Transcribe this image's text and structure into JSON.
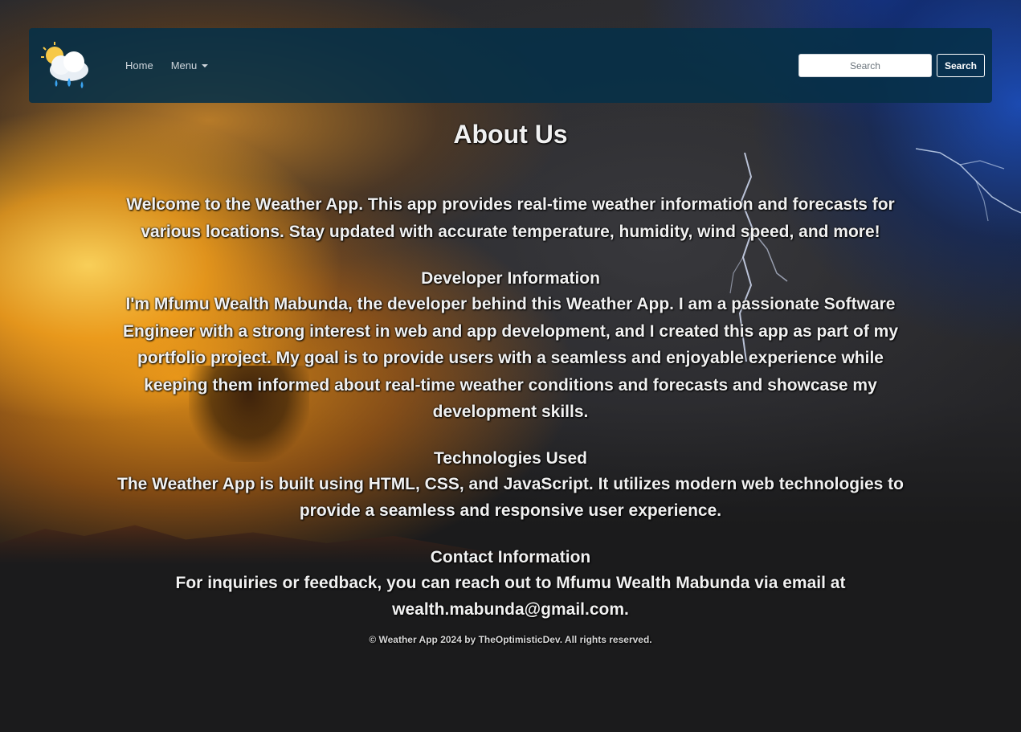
{
  "nav": {
    "logo_icon": "cloud-rain-sun-icon",
    "home_label": "Home",
    "menu_label": "Menu",
    "search_placeholder": "Search",
    "search_button_label": "Search"
  },
  "page": {
    "title": "About Us",
    "intro": "Welcome to the Weather App. This app provides real-time weather information and forecasts for various locations. Stay updated with accurate temperature, humidity, wind speed, and more!"
  },
  "sections": [
    {
      "heading": "Developer Information",
      "text": "I'm Mfumu Wealth Mabunda, the developer behind this Weather App. I am a passionate Software Engineer with a strong interest in web and app development, and I created this app as part of my portfolio project. My goal is to provide users with a seamless and enjoyable experience while keeping them informed about real-time weather conditions and forecasts and showcase my development skills."
    },
    {
      "heading": "Technologies Used",
      "text": "The Weather App is built using HTML, CSS, and JavaScript. It utilizes modern web technologies to provide a seamless and responsive user experience."
    },
    {
      "heading": "Contact Information",
      "text": "For inquiries or feedback, you can reach out to Mfumu Wealth Mabunda via email at wealth.mabunda@gmail.com."
    }
  ],
  "footer": {
    "text": "© Weather App 2024 by TheOptimisticDev. All rights reserved."
  },
  "colors": {
    "navbar_bg": "#063048",
    "text": "#f1f1f1",
    "page_bg": "#1b1b1c"
  }
}
